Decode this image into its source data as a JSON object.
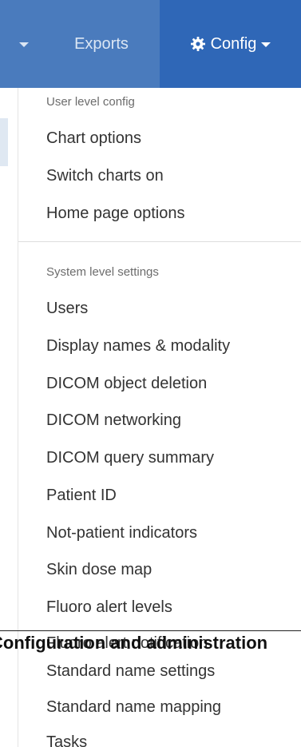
{
  "navbar": {
    "exports_label": "Exports",
    "config_label": "Config",
    "icons": {
      "left_caret": "chevron-down-icon",
      "config": "gear-icon",
      "config_caret": "chevron-down-icon"
    }
  },
  "dropdown": {
    "user_header": "User level config",
    "user_items": [
      "Chart options",
      "Switch charts on",
      "Home page options"
    ],
    "system_header": "System level settings",
    "system_items": [
      "Users",
      "Display names & modality",
      "DICOM object deletion",
      "DICOM networking",
      "DICOM query summary",
      "Patient ID",
      "Not-patient indicators",
      "Skin dose map",
      "Fluoro alert levels",
      "Fluoro alert notification",
      "Standard name settings",
      "Standard name mapping",
      "Tasks"
    ]
  },
  "caption": "Configuration and administration",
  "colors": {
    "navbar": "#4a7bbd",
    "active_nav": "#2f67b7",
    "text": "#333333",
    "header_text": "#6c6c6c"
  }
}
